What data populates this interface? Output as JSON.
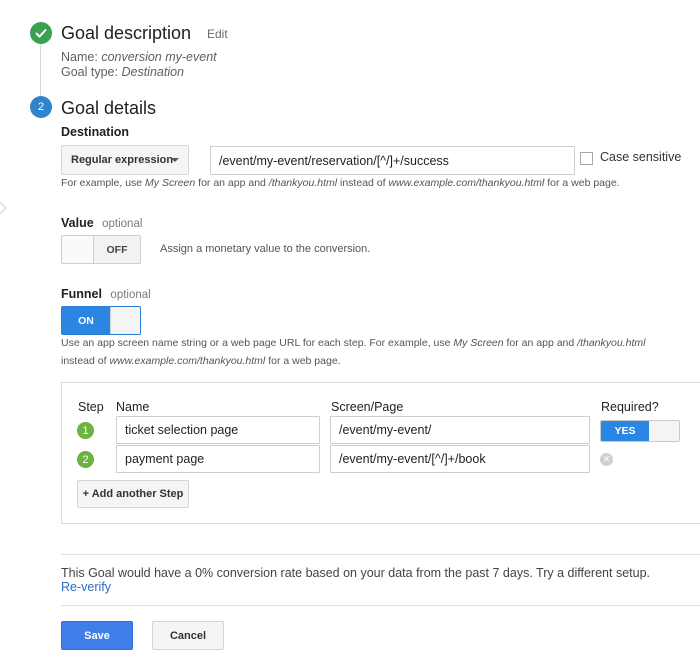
{
  "goal_description": {
    "title": "Goal description",
    "edit_label": "Edit",
    "name_label": "Name:",
    "name_value": "conversion my-event",
    "type_label": "Goal type:",
    "type_value": "Destination"
  },
  "goal_details": {
    "step_number": "2",
    "title": "Goal details",
    "destination": {
      "label": "Destination",
      "match_type": "Regular expression",
      "value": "/event/my-event/reservation/[^/]+/success",
      "case_sensitive_label": "Case sensitive",
      "case_sensitive_checked": false,
      "hint": {
        "p1": "For example, use ",
        "screen": "My Screen",
        "p2": " for an app and ",
        "thankyou": "/thankyou.html",
        "p3": " instead of ",
        "url": "www.example.com/thankyou.html",
        "p4": " for a web page."
      }
    },
    "value": {
      "label": "Value",
      "optional": "optional",
      "toggle": "OFF",
      "description": "Assign a monetary value to the conversion."
    },
    "funnel": {
      "label": "Funnel",
      "optional": "optional",
      "toggle": "ON",
      "hint": {
        "p1": "Use an app screen name string or a web page URL for each step. For example, use ",
        "screen": "My Screen",
        "p2": " for an app and ",
        "thankyou": "/thankyou.html",
        "p3": "instead of ",
        "url": "www.example.com/thankyou.html",
        "p4": " for a web page."
      },
      "columns": [
        "Step",
        "Name",
        "Screen/Page",
        "Required?"
      ],
      "rows": [
        {
          "step": "1",
          "name": "ticket selection page",
          "page": "/event/my-event/",
          "required": "YES"
        },
        {
          "step": "2",
          "name": "payment page",
          "page": "/event/my-event/[^/]+/book",
          "required": ""
        }
      ],
      "add_step": "+ Add another Step"
    }
  },
  "verify": {
    "text": "This Goal would have a 0% conversion rate based on your data from the past 7 days. Try a different setup.",
    "link": "Re-verify"
  },
  "actions": {
    "save": "Save",
    "cancel": "Cancel"
  },
  "colors": {
    "primary_blue": "#3d7ee8",
    "toggle_blue": "#2a86e2",
    "success_green": "#3aa14f",
    "step_green": "#6cb33f",
    "step_blue": "#2f84cc",
    "link_blue": "#2a6dc6"
  }
}
